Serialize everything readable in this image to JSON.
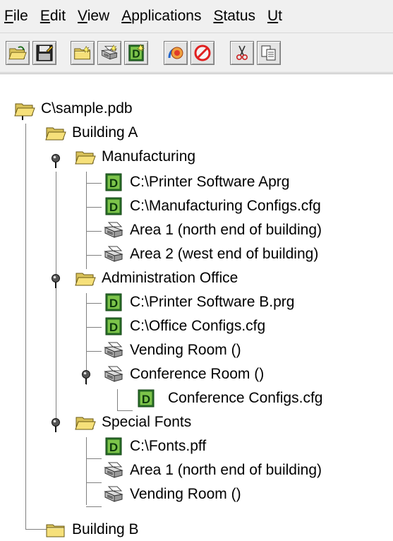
{
  "menu": [
    {
      "accel": "F",
      "rest": "ile"
    },
    {
      "accel": "E",
      "rest": "dit"
    },
    {
      "accel": "V",
      "rest": "iew"
    },
    {
      "accel": "A",
      "rest": "pplications"
    },
    {
      "accel": "S",
      "rest": "tatus"
    },
    {
      "accel": "U",
      "rest": "t"
    }
  ],
  "toolbar": [
    "open-icon",
    "save-icon",
    "new-folder-icon",
    "new-device-icon",
    "new-document-icon",
    "send-icon",
    "stop-icon",
    "cut-icon",
    "copy-icon"
  ],
  "tree": {
    "root": "C\\sample.pdb",
    "building_a": "Building A",
    "manufacturing": "Manufacturing",
    "mfg_file1": "C:\\Printer Software Aprg",
    "mfg_file2": "C:\\Manufacturing Configs.cfg",
    "mfg_area1": "Area 1 (north end of building)",
    "mfg_area2": "Area 2 (west end of building)",
    "admin": "Administration Office",
    "admin_file1": "C:\\Printer Software B.prg",
    "admin_file2": "C:\\Office Configs.cfg",
    "admin_vending": "Vending Room ()",
    "admin_conference": "Conference Room ()",
    "conf_file": "Conference Configs.cfg",
    "fonts": "Special Fonts",
    "fonts_file": "C:\\Fonts.pff",
    "fonts_area1": "Area 1 (north end of building)",
    "fonts_vending": "Vending Room ()",
    "building_b": "Building B"
  }
}
